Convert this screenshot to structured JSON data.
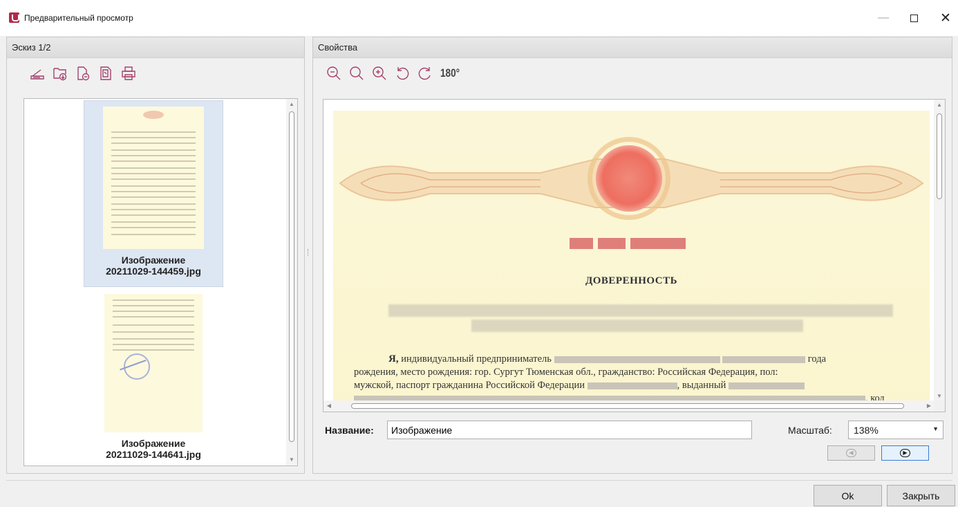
{
  "window": {
    "title": "Предварительный просмотр",
    "controls": {
      "minimize": "—",
      "close": "✕"
    }
  },
  "left_panel": {
    "header": "Эскиз 1/2",
    "toolbar": [
      "scanner-icon",
      "add-folder-icon",
      "remove-page-icon",
      "copy-page-icon",
      "print-icon"
    ],
    "thumbnails": [
      {
        "name_line1": "Изображение",
        "name_line2": "20211029-144459.jpg",
        "selected": true
      },
      {
        "name_line1": "Изображение",
        "name_line2": "20211029-144641.jpg",
        "selected": false
      }
    ]
  },
  "right_panel": {
    "header": "Свойства",
    "toolbar": [
      "zoom-out-icon",
      "zoom-fit-icon",
      "zoom-in-icon",
      "rotate-left-icon",
      "rotate-right-icon"
    ],
    "rotate180": "180°",
    "document": {
      "title": "ДОВЕРЕННОСТЬ",
      "line1_start": "Я,",
      "line1_text": " индивидуальный предприниматель",
      "line1_end": "года",
      "line2": "рождения, место рождения: гор. Сургут Тюменская обл., гражданство: Российская Федерация, пол:",
      "line3": "мужской, паспорт гражданина Российской Федерации",
      "line3_mid": ", выданный",
      "line4_end": ", код"
    },
    "name_label": "Название:",
    "name_value": "Изображение",
    "scale_label": "Масштаб:",
    "scale_value": "138%"
  },
  "buttons": {
    "ok": "Ok",
    "close": "Закрыть"
  },
  "colors": {
    "accent": "#3a7bd5",
    "icon": "#a3416b",
    "doc_bg": "#fbf6d8"
  }
}
